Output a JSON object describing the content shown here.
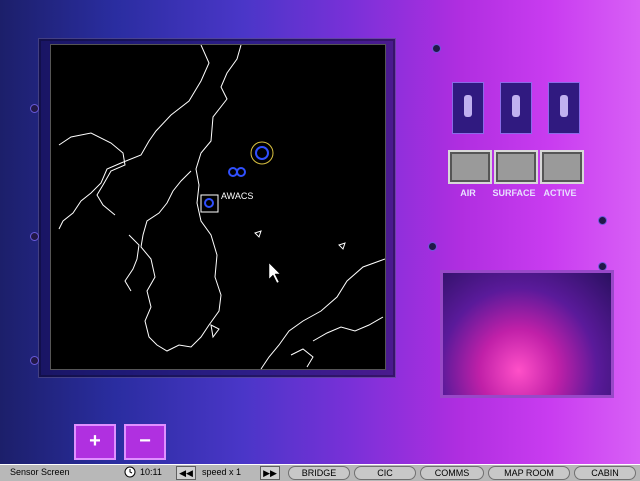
{
  "radar": {
    "awacs_label": "AWACS"
  },
  "sensors": {
    "air_label": "AIR",
    "surface_label": "SURFACE",
    "active_label": "ACTIVE"
  },
  "zoom": {
    "plus_label": "+",
    "minus_label": "−"
  },
  "statusbar": {
    "screen_name": "Sensor Screen",
    "time": "10:11",
    "speed_label": "speed x 1",
    "nav": [
      "BRIDGE",
      "CIC",
      "COMMS",
      "MAP ROOM",
      "CABIN"
    ]
  },
  "colors": {
    "console_gradient_start": "#1c1f6a",
    "console_gradient_end": "#d860f6",
    "coastline": "#ffffff",
    "contact_blue": "#3050ff",
    "contact_yellow": "#d8c040"
  },
  "icons": {
    "clock": "clock-icon",
    "rewind": "rewind-icon",
    "fast_forward": "fast-forward-icon"
  }
}
